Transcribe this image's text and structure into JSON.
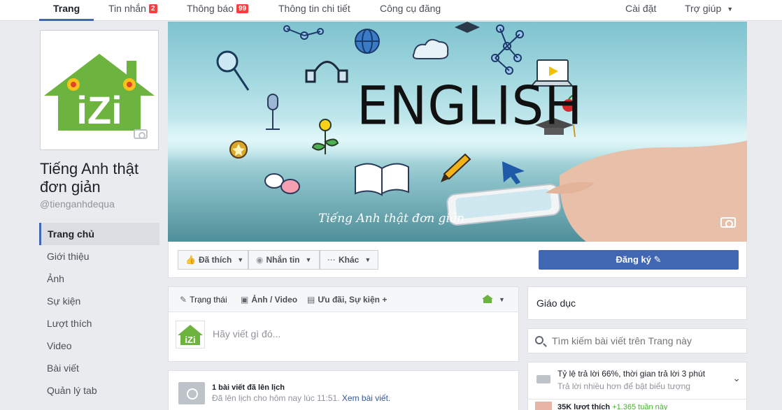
{
  "topnav": {
    "tabs": [
      {
        "label": "Trang"
      },
      {
        "label": "Tin nhắn",
        "badge": "2"
      },
      {
        "label": "Thông báo",
        "badge": "99"
      },
      {
        "label": "Thông tin chi tiết"
      },
      {
        "label": "Công cụ đăng"
      }
    ],
    "settings": "Cài đặt",
    "help": "Trợ giúp"
  },
  "page": {
    "name": "Tiếng Anh thật đơn giản",
    "handle": "@tienganhdequa",
    "logo_text": "iZi"
  },
  "leftnav": {
    "items": [
      {
        "label": "Trang chủ",
        "active": true
      },
      {
        "label": "Giới thiệu"
      },
      {
        "label": "Ảnh"
      },
      {
        "label": "Sự kiện"
      },
      {
        "label": "Lượt thích"
      },
      {
        "label": "Video"
      },
      {
        "label": "Bài viết"
      },
      {
        "label": "Quản lý tab"
      }
    ]
  },
  "cover": {
    "headline": "ENGLISH",
    "subtitle": "Tiếng Anh thật đơn giản"
  },
  "actions": {
    "liked": "Đã thích",
    "message": "Nhắn tin",
    "more": "Khác",
    "signup": "Đăng ký"
  },
  "composer": {
    "tabs": [
      "Trạng thái",
      "Ảnh / Video",
      "Ưu đãi, Sự kiện +"
    ],
    "placeholder": "Hãy viết gì đó..."
  },
  "scheduled": {
    "title": "1 bài viết đã lên lịch",
    "subtitle": "Đã lên lịch cho hôm nay lúc 11:51.",
    "link": "Xem bài viết."
  },
  "sidebar": {
    "category": "Giáo dục",
    "search_placeholder": "Tìm kiếm bài viết trên Trang này",
    "response_title": "Tỷ lệ trả lời 66%, thời gian trả lời 3 phút",
    "response_sub": "Trả lời nhiều hơn để bật biểu tượng",
    "likes_text": "35K lượt thích",
    "likes_delta": "+1.365 tuần này"
  },
  "colors": {
    "accent": "#4267b2",
    "badge": "#fa3e3e",
    "logo_green": "#6db33f"
  }
}
